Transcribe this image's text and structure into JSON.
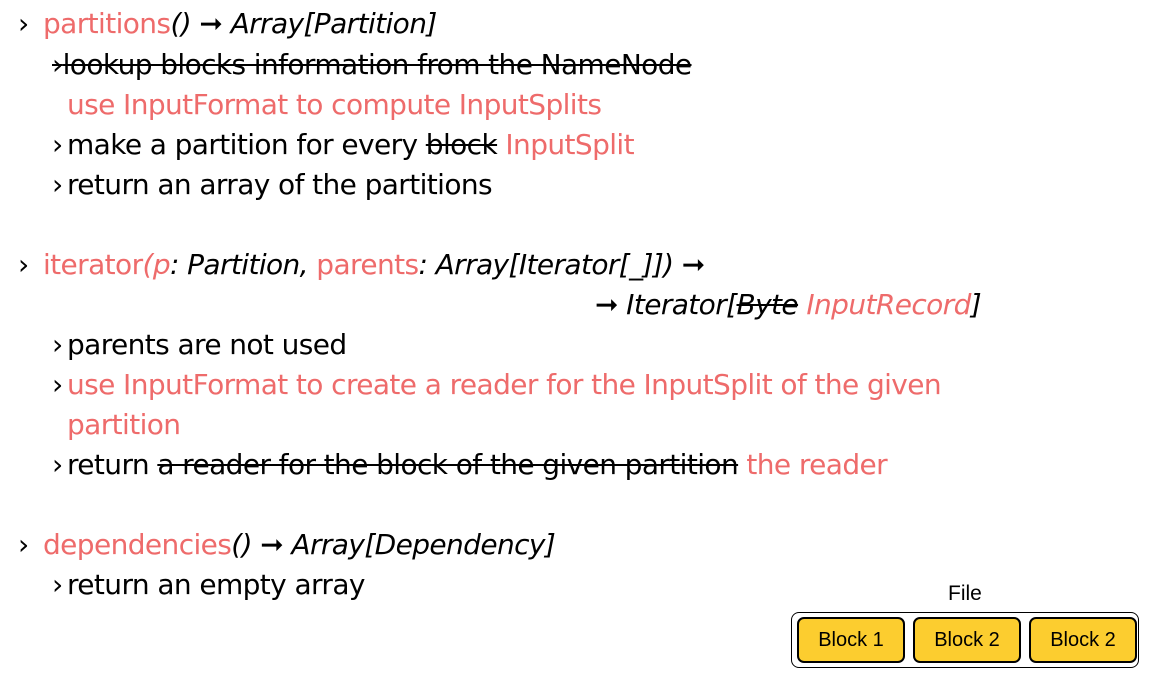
{
  "bullet": "›",
  "arrow": "➞",
  "partitions": {
    "name": "partitions",
    "signature": "() ",
    "return_type": "Array[Partition]",
    "struck_step": "lookup blocks information from the NameNode",
    "new_step": "use InputFormat to compute InputSplits",
    "step2_prefix": "make a partition for every ",
    "step2_struck": "block",
    "step2_new": "InputSplit",
    "step3": "return an array of the partitions"
  },
  "iterator": {
    "name": "iterator",
    "open_paren": "(",
    "param1": "p",
    "param1_type": ": Partition, ",
    "param2": "parents",
    "param2_type": ": Array[Iterator[_]]) ",
    "return_prefix": " Iterator[",
    "return_struck": "Byte",
    "return_new": "InputRecord",
    "return_suffix": "]",
    "step1": "parents are not used",
    "step2_line1": "use InputFormat to create a reader for the InputSplit of the given",
    "step2_line2": "partition",
    "step3_prefix": "return ",
    "step3_struck": "a reader for the block of the given partition",
    "step3_new": " the reader"
  },
  "dependencies": {
    "name": "dependencies",
    "signature": "() ",
    "return_type": "Array[Dependency]",
    "step1": "return an empty array"
  },
  "diagram": {
    "file_label": "File",
    "blocks": [
      "Block 1",
      "Block 2",
      "Block 2"
    ],
    "block_color": "#fccd2f"
  },
  "colors": {
    "accent": "#ee6b6b",
    "text": "#000000"
  }
}
